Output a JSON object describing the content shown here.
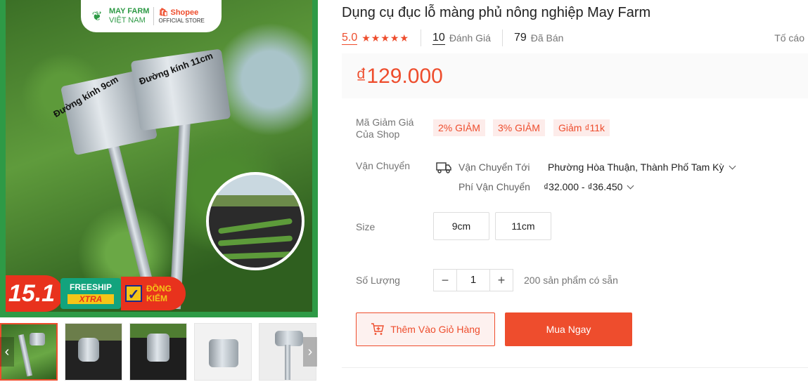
{
  "gallery": {
    "brand": {
      "line1": "MAY FARM",
      "line2": "VIỆT NAM",
      "shopee": "Shopee",
      "shopee_sub": "OFFICIAL STORE"
    },
    "cup_labels": {
      "small": "Đường kính 9cm",
      "large": "Đường kính 11cm"
    },
    "promo": {
      "number": "15.1",
      "freeship": "FREESHIP",
      "xtra": "XTRA",
      "check_line1": "ĐỒNG",
      "check_line2": "KIỂM"
    },
    "thumb_prev": "‹",
    "thumb_next": "›"
  },
  "product": {
    "title": "Dụng cụ đục lỗ màng phủ nông nghiệp May Farm",
    "rating": "5.0",
    "stars": "★★★★★",
    "reviews_count": "10",
    "reviews_label": "Đánh Giá",
    "sold_count": "79",
    "sold_label": "Đã Bán",
    "report": "Tố cáo",
    "price": "₫129.000"
  },
  "vouchers": {
    "label": "Mã Giảm Giá Của Shop",
    "items": [
      "2% GIẢM",
      "3% GIẢM",
      "Giảm ₫11k"
    ]
  },
  "shipping": {
    "label": "Vận Chuyển",
    "to_label": "Vận Chuyển Tới",
    "to_value": "Phường Hòa Thuận, Thành Phố Tam Kỳ",
    "fee_label": "Phí Vận Chuyển",
    "fee_value": "₫32.000 - ₫36.450"
  },
  "size": {
    "label": "Size",
    "options": [
      "9cm",
      "11cm"
    ]
  },
  "quantity": {
    "label": "Số Lượng",
    "minus": "−",
    "value": "1",
    "plus": "+",
    "stock": "200 sản phẩm có sẵn"
  },
  "actions": {
    "add_to_cart": "Thêm Vào Giỏ Hàng",
    "buy_now": "Mua Ngay"
  },
  "colors": {
    "accent": "#ee4d2d",
    "brand_green": "#2e9a46"
  }
}
